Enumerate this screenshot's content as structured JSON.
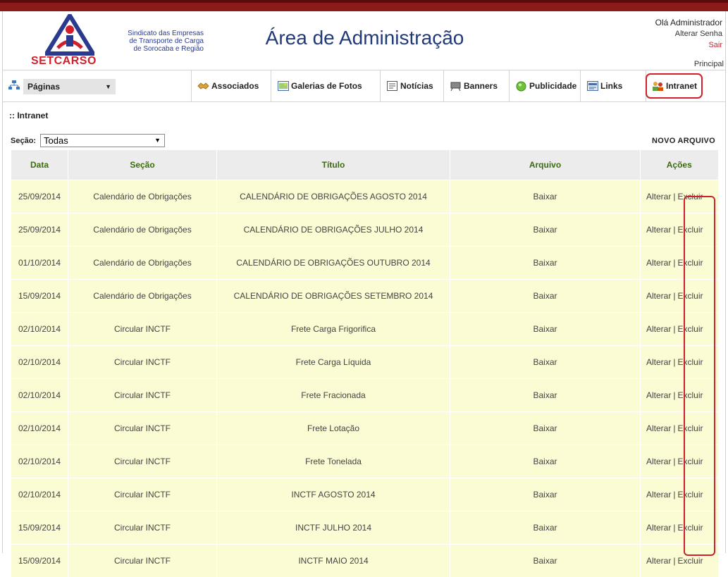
{
  "header": {
    "logo_text_lines": [
      "Sindicato das Empresas",
      "de Transporte de Carga",
      "de Sorocaba e Região"
    ],
    "logo_name": "SETCARSO",
    "title": "Área de Administração",
    "greeting": "Olá Administrador",
    "change_password": "Alterar Senha",
    "logout": "Sair",
    "principal": "Principal"
  },
  "nav": {
    "pages_select": "Páginas",
    "items": [
      {
        "label": "Associados",
        "icon": "handshake-icon"
      },
      {
        "label": "Galerias de Fotos",
        "icon": "photo-gallery-icon"
      },
      {
        "label": "Notícias",
        "icon": "news-icon"
      },
      {
        "label": "Banners",
        "icon": "banner-icon"
      },
      {
        "label": "Publicidade",
        "icon": "advertising-icon"
      },
      {
        "label": "Links",
        "icon": "links-icon"
      },
      {
        "label": "Intranet",
        "icon": "intranet-users-icon"
      }
    ]
  },
  "breadcrumb": ":: Intranet",
  "filter": {
    "label": "Seção:",
    "value": "Todas"
  },
  "new_file": "NOVO ARQUIVO",
  "table": {
    "headers": [
      "Data",
      "Seção",
      "Título",
      "Arquivo",
      "Ações"
    ],
    "download_label": "Baixar",
    "edit_label": "Alterar",
    "separator": "|",
    "delete_label": "Excluir",
    "rows": [
      {
        "date": "25/09/2014",
        "section": "Calendário de Obrigações",
        "title": "CALENDÁRIO DE OBRIGAÇÕES AGOSTO 2014"
      },
      {
        "date": "25/09/2014",
        "section": "Calendário de Obrigações",
        "title": "CALENDÁRIO DE OBRIGAÇÕES JULHO 2014"
      },
      {
        "date": "01/10/2014",
        "section": "Calendário de Obrigações",
        "title": "CALENDÁRIO DE OBRIGAÇÕES OUTUBRO 2014"
      },
      {
        "date": "15/09/2014",
        "section": "Calendário de Obrigações",
        "title": "CALENDÁRIO DE OBRIGAÇÕES SETEMBRO 2014"
      },
      {
        "date": "02/10/2014",
        "section": "Circular INCTF",
        "title": "Frete Carga Frigorifica"
      },
      {
        "date": "02/10/2014",
        "section": "Circular INCTF",
        "title": "Frete Carga Líquida"
      },
      {
        "date": "02/10/2014",
        "section": "Circular INCTF",
        "title": "Frete Fracionada"
      },
      {
        "date": "02/10/2014",
        "section": "Circular INCTF",
        "title": "Frete Lotação"
      },
      {
        "date": "02/10/2014",
        "section": "Circular INCTF",
        "title": "Frete Tonelada"
      },
      {
        "date": "02/10/2014",
        "section": "Circular INCTF",
        "title": "INCTF AGOSTO 2014"
      },
      {
        "date": "15/09/2014",
        "section": "Circular INCTF",
        "title": "INCTF JULHO 2014"
      },
      {
        "date": "15/09/2014",
        "section": "Circular INCTF",
        "title": "INCTF MAIO 2014"
      }
    ]
  },
  "colors": {
    "brand_red": "#d11f2b",
    "brand_blue": "#223a7a",
    "row_bg": "#fbfbd4",
    "header_text": "#3d6b12"
  }
}
